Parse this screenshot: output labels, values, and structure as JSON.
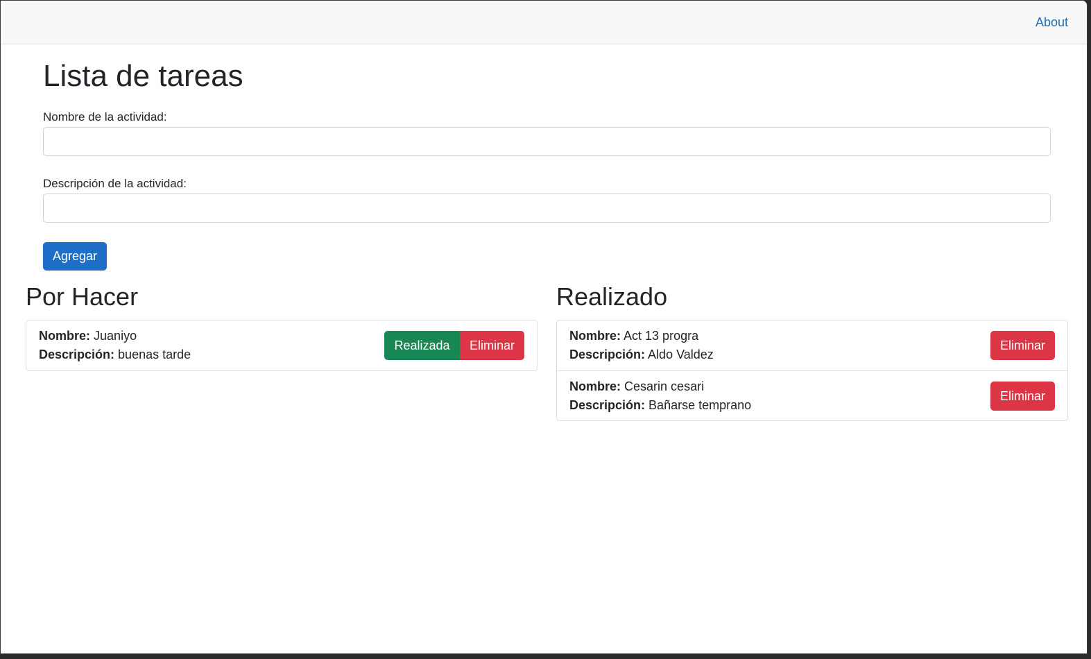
{
  "navbar": {
    "about_label": "About"
  },
  "page": {
    "title": "Lista de tareas"
  },
  "form": {
    "name_label": "Nombre de la actividad:",
    "name_value": "",
    "description_label": "Descripción de la actividad:",
    "description_value": "",
    "add_button": "Agregar"
  },
  "labels": {
    "name_key": "Nombre:",
    "description_key": "Descripción:"
  },
  "todo": {
    "title": "Por Hacer",
    "items": [
      {
        "name": "Juaniyo",
        "description": "buenas tarde",
        "done_button": "Realizada",
        "delete_button": "Eliminar"
      }
    ]
  },
  "done": {
    "title": "Realizado",
    "items": [
      {
        "name": "Act 13 progra",
        "description": "Aldo Valdez",
        "delete_button": "Eliminar"
      },
      {
        "name": "Cesarin cesari",
        "description": "Bañarse temprano",
        "delete_button": "Eliminar"
      }
    ]
  },
  "colors": {
    "primary": "#1d6fc8",
    "success": "#198754",
    "danger": "#dc3545"
  }
}
